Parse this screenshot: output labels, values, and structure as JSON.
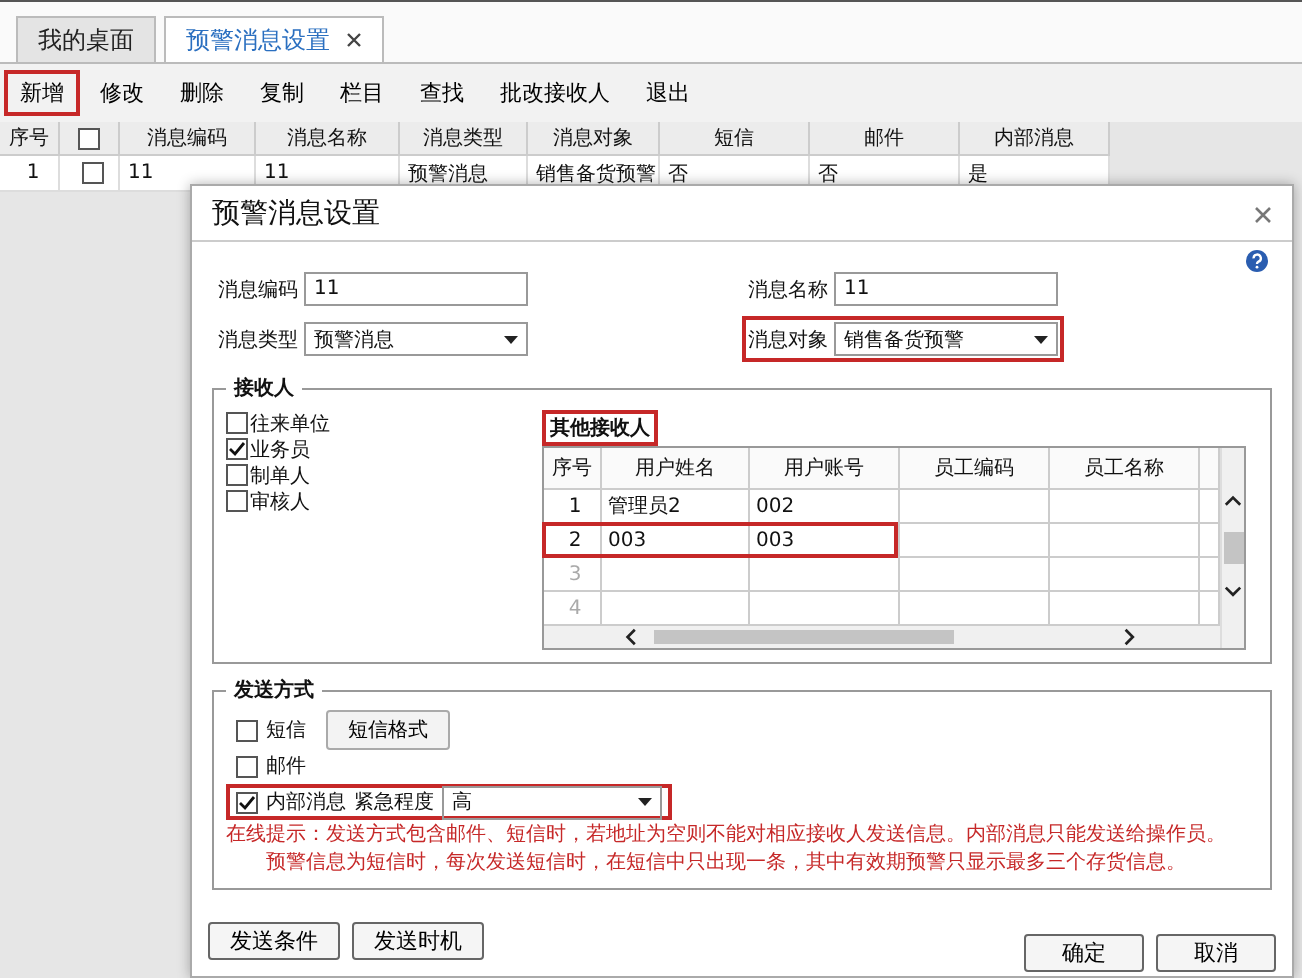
{
  "tabs": [
    {
      "label": "我的桌面",
      "selected": false,
      "closable": false
    },
    {
      "label": "预警消息设置",
      "selected": true,
      "closable": true
    }
  ],
  "toolbar": [
    {
      "label": "新增",
      "highlighted": true
    },
    {
      "label": "修改",
      "highlighted": false
    },
    {
      "label": "删除",
      "highlighted": false
    },
    {
      "label": "复制",
      "highlighted": false
    },
    {
      "label": "栏目",
      "highlighted": false
    },
    {
      "label": "查找",
      "highlighted": false
    },
    {
      "label": "批改接收人",
      "highlighted": false
    },
    {
      "label": "退出",
      "highlighted": false
    }
  ],
  "table": {
    "columns": [
      {
        "kind": "text",
        "label": "序号"
      },
      {
        "kind": "checkbox",
        "checked": false
      },
      {
        "kind": "text",
        "label": "消息编码"
      },
      {
        "kind": "text",
        "label": "消息名称"
      },
      {
        "kind": "text",
        "label": "消息类型"
      },
      {
        "kind": "text",
        "label": "消息对象"
      },
      {
        "kind": "text",
        "label": "短信"
      },
      {
        "kind": "text",
        "label": "邮件"
      },
      {
        "kind": "text",
        "label": "内部消息"
      }
    ],
    "rows": [
      {
        "cells": [
          {
            "kind": "text",
            "text": "1"
          },
          {
            "kind": "checkbox",
            "checked": false
          },
          {
            "kind": "text",
            "text": "11"
          },
          {
            "kind": "text",
            "text": "11"
          },
          {
            "kind": "text",
            "text": "预警消息"
          },
          {
            "kind": "text",
            "text": "销售备货预警"
          },
          {
            "kind": "text",
            "text": "否"
          },
          {
            "kind": "text",
            "text": "否"
          },
          {
            "kind": "text",
            "text": "是"
          }
        ]
      }
    ]
  },
  "dialog": {
    "title": "预警消息设置",
    "fields": [
      {
        "kind": "text",
        "label": "消息编码",
        "value": "11",
        "highlighted": false
      },
      {
        "kind": "text",
        "label": "消息名称",
        "value": "11",
        "highlighted": false
      },
      {
        "kind": "select",
        "label": "消息类型",
        "value": "预警消息",
        "highlighted": false
      },
      {
        "kind": "select",
        "label": "消息对象",
        "value": "销售备货预警",
        "highlighted": true
      }
    ],
    "receivers": {
      "legend": "接收人",
      "options": [
        {
          "label": "往来单位",
          "checked": false
        },
        {
          "label": "业务员",
          "checked": true
        },
        {
          "label": "制单人",
          "checked": false
        },
        {
          "label": "审核人",
          "checked": false
        }
      ],
      "others": {
        "legend": "其他接收人",
        "highlighted": true,
        "columns": [
          "序号",
          "用户姓名",
          "用户账号",
          "员工编码",
          "员工名称"
        ],
        "rows": [
          {
            "number": "1",
            "cells": [
              "管理员2",
              "002"
            ],
            "filled": true,
            "highlighted": false
          },
          {
            "number": "2",
            "cells": [
              "003",
              "003"
            ],
            "filled": true,
            "highlighted": true
          },
          {
            "number": "3",
            "cells": [],
            "filled": false,
            "highlighted": false
          },
          {
            "number": "4",
            "cells": [],
            "filled": false,
            "highlighted": false
          }
        ]
      }
    },
    "send": {
      "legend": "发送方式",
      "options": [
        {
          "kind": "button",
          "label": "短信",
          "checked": false,
          "button": "短信格式",
          "highlighted": false
        },
        {
          "kind": "plain",
          "label": "邮件",
          "checked": false,
          "highlighted": false
        },
        {
          "kind": "urgency",
          "label": "内部消息",
          "checked": true,
          "urgency_label": "紧急程度",
          "urgency": "高",
          "highlighted": true
        }
      ],
      "hints": [
        "在线提示：发送方式包含邮件、短信时，若地址为空则不能对相应接收人发送信息。内部消息只能发送给操作员。",
        "预警信息为短信时，每次发送短信时，在短信中只出现一条，其中有效期预警只显示最多三个存货信息。"
      ]
    },
    "buttons": [
      "发送条件",
      "发送时机"
    ],
    "actions": [
      "确定",
      "取消"
    ]
  }
}
